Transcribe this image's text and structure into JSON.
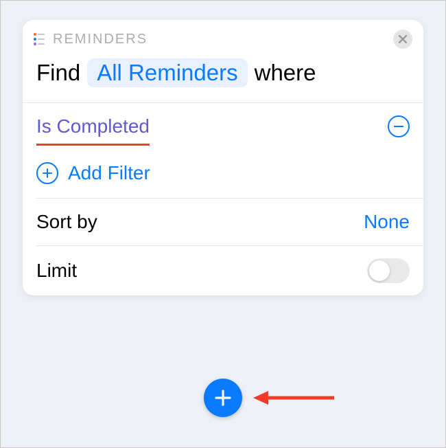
{
  "header": {
    "app_title": "REMINDERS"
  },
  "query": {
    "prefix": "Find",
    "token": "All Reminders",
    "suffix": "where"
  },
  "filters": {
    "items": [
      {
        "label": "Is Completed"
      }
    ],
    "add_label": "Add Filter"
  },
  "sort": {
    "label": "Sort by",
    "value": "None"
  },
  "limit": {
    "label": "Limit",
    "enabled": false
  },
  "colors": {
    "accent_blue": "#0a7aff",
    "accent_purple": "#6159d4",
    "annotation_red": "#ef3b29"
  },
  "icons": {
    "close": "close-icon",
    "remove_filter": "minus-circle-icon",
    "add_filter": "plus-circle-icon",
    "fab": "plus-icon",
    "reminders": "reminders-app-icon"
  }
}
